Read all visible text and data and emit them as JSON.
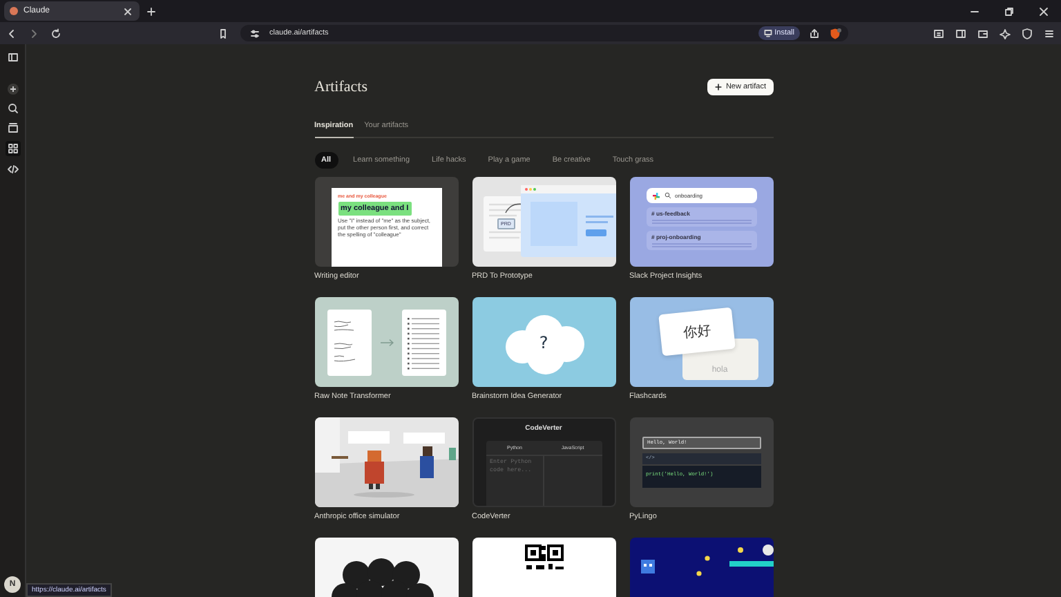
{
  "browser": {
    "tab_title": "Claude",
    "url": "claude.ai/artifacts",
    "install": "Install"
  },
  "sidebar": {
    "avatar": "N"
  },
  "page": {
    "title": "Artifacts",
    "new_button": "New artifact",
    "tabs": [
      {
        "label": "Inspiration",
        "selected": true
      },
      {
        "label": "Your artifacts",
        "selected": false
      }
    ],
    "filters": [
      {
        "label": "All",
        "selected": true
      },
      {
        "label": "Learn something",
        "selected": false
      },
      {
        "label": "Life hacks",
        "selected": false
      },
      {
        "label": "Play a game",
        "selected": false
      },
      {
        "label": "Be creative",
        "selected": false
      },
      {
        "label": "Touch grass",
        "selected": false
      }
    ]
  },
  "cards": [
    {
      "title": "Writing editor",
      "thumb": {
        "kind": "writing",
        "texts": [
          "me and my colleague",
          "my colleague and I",
          "Use \"I\" instead of \"me\" as the subject, put the other person first, and correct the spelling of \"colleague\""
        ]
      }
    },
    {
      "title": "PRD To Prototype",
      "thumb": {
        "kind": "prd",
        "texts": [
          "PRD"
        ]
      }
    },
    {
      "title": "Slack Project Insights",
      "thumb": {
        "kind": "slack",
        "texts": [
          "onboarding",
          "# us-feedback",
          "# proj-onboarding"
        ]
      }
    },
    {
      "title": "Raw Note Transformer",
      "thumb": {
        "kind": "notes"
      }
    },
    {
      "title": "Brainstorm Idea Generator",
      "thumb": {
        "kind": "cloud",
        "texts": [
          "?"
        ]
      }
    },
    {
      "title": "Flashcards",
      "thumb": {
        "kind": "flash",
        "texts": [
          "你好",
          "hola"
        ]
      }
    },
    {
      "title": "Anthropic office simulator"
    },
    {
      "title": "CodeVerter",
      "thumb": {
        "kind": "code",
        "texts": [
          "CodeVerter",
          "Python",
          "JavaScript",
          "Enter Python code here..."
        ]
      }
    },
    {
      "title": "PyLingo",
      "thumb": {
        "kind": "py",
        "texts": [
          "Hello, World!",
          "</>",
          "print('Hello, World!')"
        ]
      }
    },
    {
      "thumb": {
        "kind": "balls"
      }
    },
    {
      "thumb": {
        "kind": "qr"
      }
    },
    {
      "thumb": {
        "kind": "game"
      }
    }
  ],
  "status_url": "https://claude.ai/artifacts"
}
